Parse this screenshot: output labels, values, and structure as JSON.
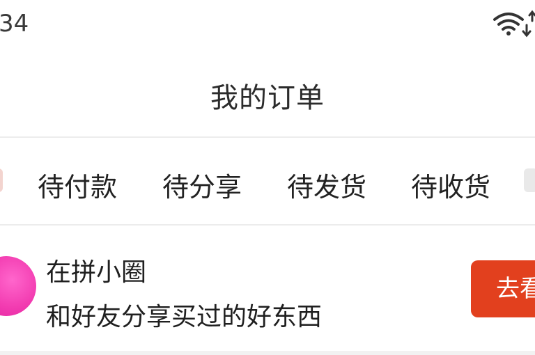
{
  "status_bar": {
    "time": "34",
    "icons": [
      "wifi-icon"
    ]
  },
  "header": {
    "title": "我的订单"
  },
  "order_tabs": {
    "items": [
      {
        "label": "待付款"
      },
      {
        "label": "待分享"
      },
      {
        "label": "待发货"
      },
      {
        "label": "待收货"
      }
    ]
  },
  "group_banner": {
    "title": "在拼小圈",
    "subtitle": "和好友分享买过的好东西",
    "button_label": "去看",
    "button_color": "#e2401e",
    "avatar_color": "#f23bb0"
  }
}
